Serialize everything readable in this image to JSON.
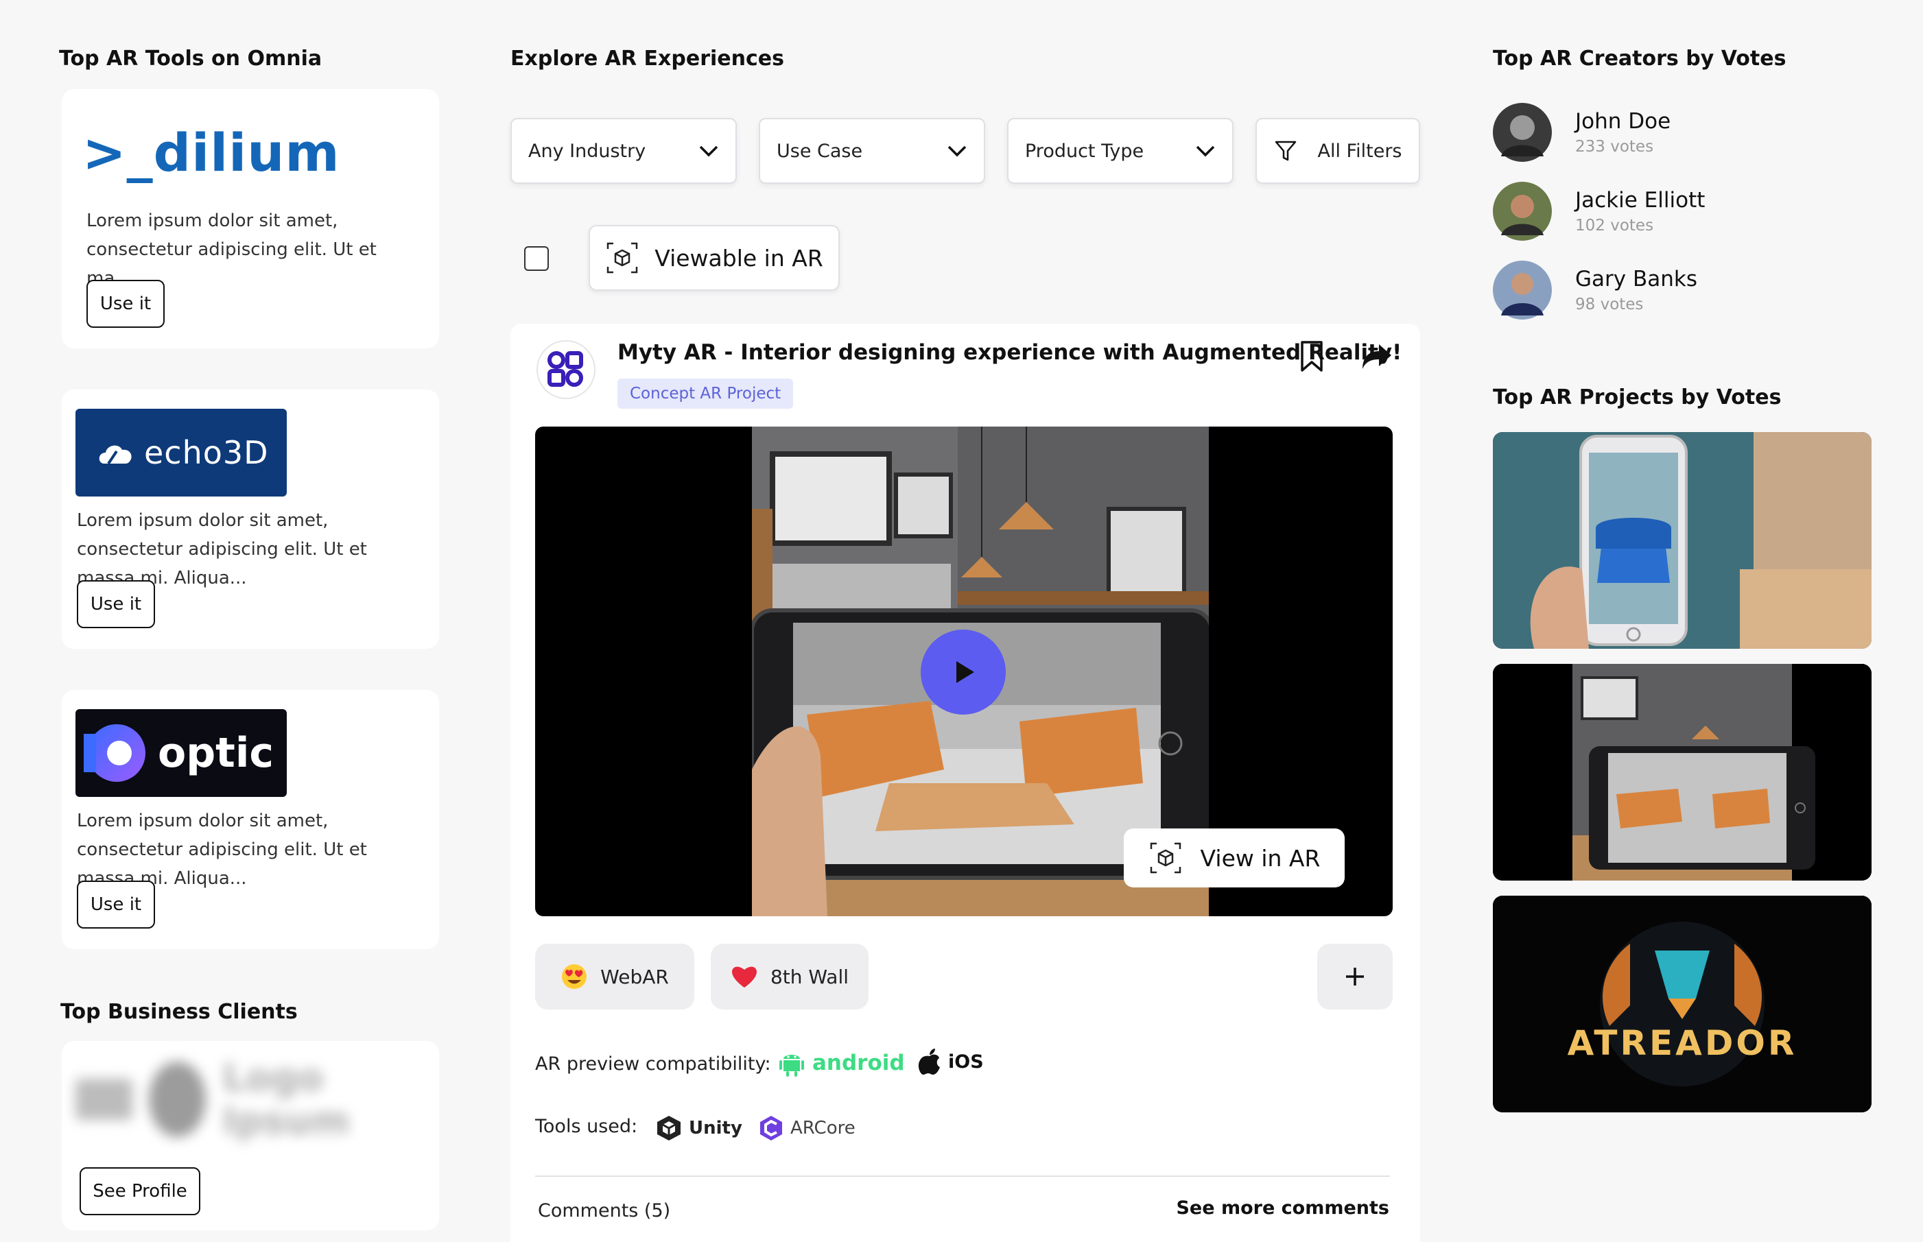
{
  "left": {
    "tools_title": "Top AR Tools on Omnia",
    "tools": [
      {
        "logo": ">_dilium",
        "description": "Lorem ipsum dolor sit amet, consectetur adipiscing elit. Ut et ma...",
        "button": "Use it"
      },
      {
        "logo": "echo3D",
        "description": "Lorem ipsum dolor sit amet, consectetur adipiscing elit. Ut et massa mi. Aliqua...",
        "button": "Use it"
      },
      {
        "logo": "optic",
        "description": "Lorem ipsum dolor sit amet, consectetur adipiscing elit. Ut et massa mi. Aliqua...",
        "button": "Use it"
      }
    ],
    "clients_title": "Top Business Clients",
    "client_logo_text": "Logo Ipsum",
    "client_button": "See Profile"
  },
  "center": {
    "title": "Explore AR Experiences",
    "filters": {
      "industry": "Any Industry",
      "use_case": "Use Case",
      "product_type": "Product Type",
      "all_filters": "All Filters"
    },
    "viewable_label": "Viewable in AR",
    "post": {
      "title": "Myty AR - Interior designing experience with Augmented Reality!",
      "tag": "Concept AR Project",
      "view_in_ar": "View in AR",
      "chips": [
        {
          "label": "WebAR",
          "icon": "heart-eyes-emoji-icon"
        },
        {
          "label": "8th Wall",
          "icon": "red-heart-icon"
        }
      ],
      "compat_label": "AR preview compatibility:",
      "android_label": "android",
      "ios_label": "iOS",
      "tools_label": "Tools used:",
      "unity_label": "Unity",
      "arcore_label": "ARCore",
      "comments_label": "Comments (5)",
      "see_more": "See more comments"
    }
  },
  "right": {
    "creators_title": "Top AR Creators by Votes",
    "creators": [
      {
        "name": "John Doe",
        "votes": "233 votes"
      },
      {
        "name": "Jackie Elliott",
        "votes": "102 votes"
      },
      {
        "name": "Gary Banks",
        "votes": "98 votes"
      }
    ],
    "projects_title": "Top AR Projects by Votes",
    "project3_logo_text": "ATREADOR"
  },
  "colors": {
    "accent": "#5c5cf0",
    "tag_bg": "#e6e8fb",
    "tag_text": "#5b62d8",
    "android_green": "#3ddc84",
    "dilium_blue": "#1467b8",
    "echo_navy": "#0e3a79"
  }
}
